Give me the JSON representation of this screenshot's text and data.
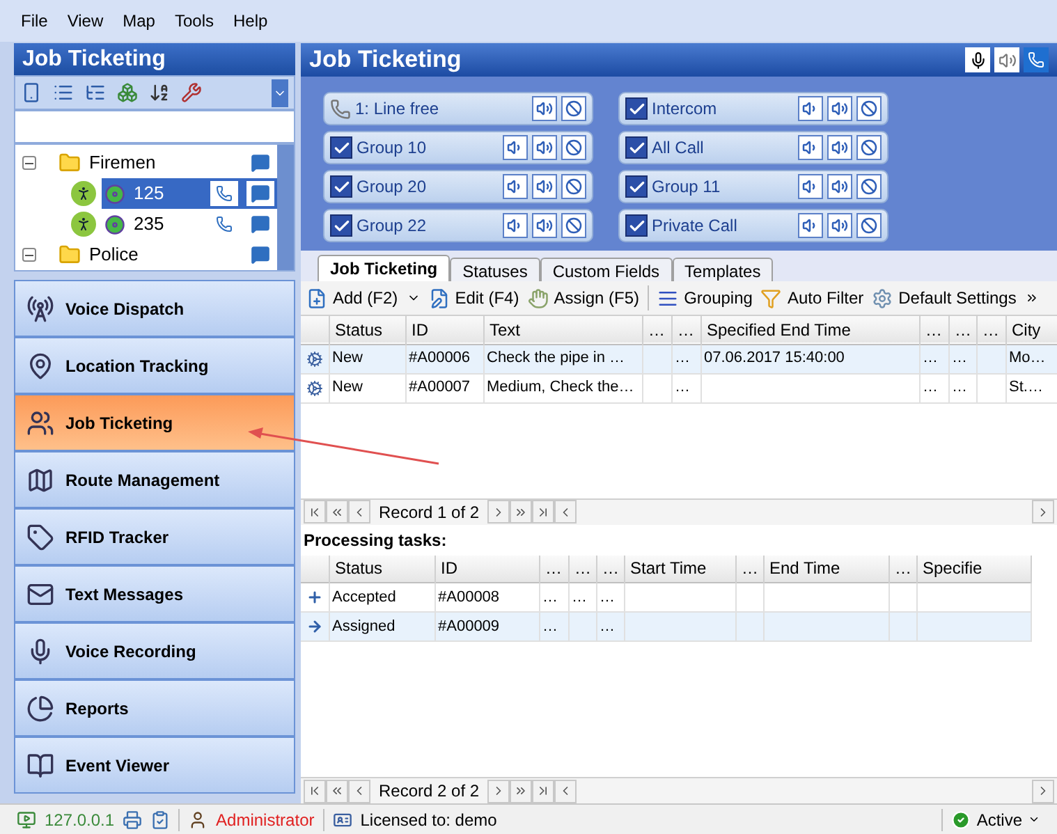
{
  "menu": [
    "File",
    "View",
    "Map",
    "Tools",
    "Help"
  ],
  "sidebar": {
    "title": "Job Ticketing",
    "tree": [
      {
        "label": "Firemen",
        "expanded": true,
        "children": [
          {
            "label": "125",
            "selected": true
          },
          {
            "label": "235",
            "selected": false
          }
        ]
      },
      {
        "label": "Police",
        "expanded": true
      }
    ],
    "nav": [
      {
        "label": "Voice Dispatch",
        "kind": "dispatch",
        "selected": false
      },
      {
        "label": "Location Tracking",
        "kind": "location",
        "selected": false
      },
      {
        "label": "Job Ticketing",
        "kind": "jobs",
        "selected": true
      },
      {
        "label": "Route Management",
        "kind": "route",
        "selected": false
      },
      {
        "label": "RFID Tracker",
        "kind": "rfid",
        "selected": false
      },
      {
        "label": "Text Messages",
        "kind": "messages",
        "selected": false
      },
      {
        "label": "Voice Recording",
        "kind": "recording",
        "selected": false
      },
      {
        "label": "Reports",
        "kind": "reports",
        "selected": false
      },
      {
        "label": "Event Viewer",
        "kind": "events",
        "selected": false
      }
    ]
  },
  "main": {
    "title": "Job Ticketing",
    "channels": [
      {
        "label": "1: Line free",
        "kind": "line"
      },
      {
        "label": "Group 10",
        "kind": "group",
        "checked": true
      },
      {
        "label": "Group 20",
        "kind": "group",
        "checked": true
      },
      {
        "label": "Group 22",
        "kind": "group",
        "checked": true
      },
      {
        "label": "Intercom",
        "kind": "group",
        "checked": true
      },
      {
        "label": "All Call",
        "kind": "group",
        "checked": true
      },
      {
        "label": "Group 11",
        "kind": "group",
        "checked": true
      },
      {
        "label": "Private Call",
        "kind": "group",
        "checked": true
      }
    ],
    "tabs": [
      {
        "label": "Job Ticketing",
        "selected": true
      },
      {
        "label": "Statuses",
        "selected": false
      },
      {
        "label": "Custom Fields",
        "selected": false
      },
      {
        "label": "Templates",
        "selected": false
      }
    ],
    "toolbar": [
      {
        "label": "Add (F2)",
        "kind": "add"
      },
      {
        "label": "Edit (F4)",
        "kind": "edit"
      },
      {
        "label": "Assign (F5)",
        "kind": "assign"
      },
      {
        "label": "Grouping",
        "kind": "grouping"
      },
      {
        "label": "Auto Filter",
        "kind": "filter"
      },
      {
        "label": "Default Settings",
        "kind": "settings"
      }
    ],
    "jobs_table": {
      "columns": [
        "Status",
        "ID",
        "Text",
        "…",
        "…",
        "Specified End Time",
        "…",
        "…",
        "…",
        "City"
      ],
      "rows": [
        {
          "selected": true,
          "cells": [
            "New",
            "#A00006",
            "Check the pipe in …",
            null,
            "…",
            "07.06.2017 15:40:00",
            "…",
            "…",
            null,
            "Mo…"
          ]
        },
        {
          "selected": false,
          "cells": [
            "New",
            "#A00007",
            "Medium, Check the…",
            null,
            "…",
            null,
            "…",
            "…",
            null,
            "St.…"
          ]
        }
      ],
      "pager": "Record 1 of 2"
    },
    "tasks": {
      "title": "Processing tasks:",
      "columns": [
        "Status",
        "ID",
        "…",
        "…",
        "…",
        "Start Time",
        "…",
        "End Time",
        "…",
        "Specifie"
      ],
      "rows": [
        {
          "kind": "plus",
          "selected": false,
          "cells": [
            "Accepted",
            "#A00008",
            "…",
            "…",
            "…",
            null,
            null,
            null,
            null,
            null
          ]
        },
        {
          "kind": "arrow",
          "selected": true,
          "cells": [
            "Assigned",
            "#A00009",
            "…",
            null,
            "…",
            null,
            null,
            null,
            null,
            null
          ]
        }
      ],
      "pager": "Record 2 of 2"
    }
  },
  "status_bar": {
    "address": "127.0.0.1",
    "user": "Administrator",
    "license": "Licensed to: demo",
    "state": "Active"
  }
}
